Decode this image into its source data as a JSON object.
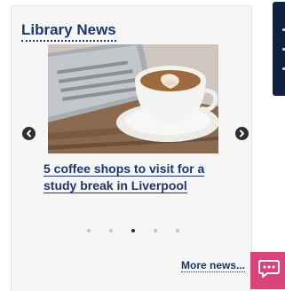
{
  "widget": {
    "title": "Library News",
    "slide": {
      "image_icon": "coffee-laptop-photo",
      "caption": "5 coffee shops to visit for a study break in Liverpool"
    },
    "prev_icon": "chevron-left-circle-icon",
    "next_icon": "chevron-right-circle-icon",
    "pagination": {
      "count": 5,
      "active_index": 2
    },
    "more_link": "More news..."
  },
  "chat": {
    "icon": "chat-bubble-icon",
    "color": "#d9447a"
  },
  "colors": {
    "accent": "#1d3866",
    "panel": "#10213f"
  }
}
